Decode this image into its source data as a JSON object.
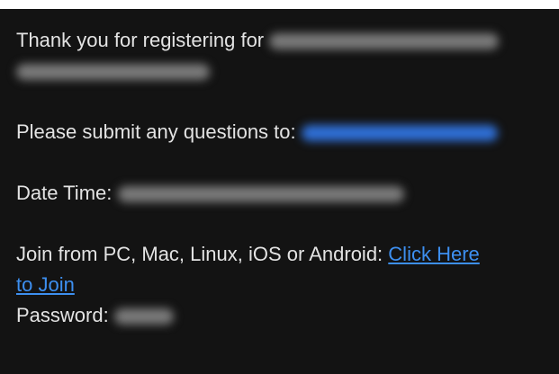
{
  "message": {
    "thanks_prefix": "Thank you for registering for",
    "questions_label": "Please submit any questions to:",
    "datetime_label": "Date Time:",
    "join_prefix": "Join from PC, Mac, Linux, iOS or Android:",
    "join_link_line1": "Click Here",
    "join_link_line2": "to Join",
    "password_label": "Password:"
  },
  "colors": {
    "background": "#131313",
    "text": "#e3e3e3",
    "link": "#3d8ff0"
  }
}
